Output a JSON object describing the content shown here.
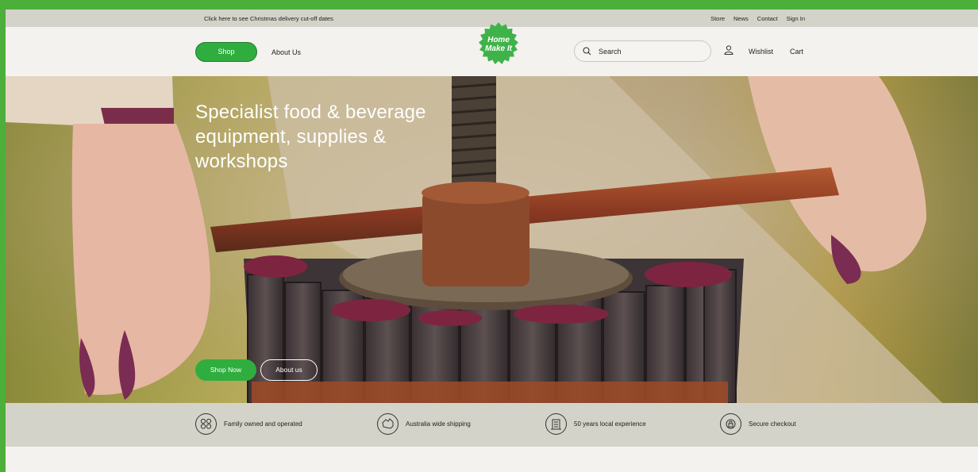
{
  "topbar": {
    "promo": "Click here to see Christmas delivery cut-off dates",
    "links": [
      "Store",
      "News",
      "Contact",
      "Sign In"
    ]
  },
  "header": {
    "shop_label": "Shop",
    "about_label": "About Us",
    "logo_line1": "Home",
    "logo_line2": "Make It",
    "search_placeholder": "Search",
    "wishlist_label": "Wishlist",
    "cart_label": "Cart"
  },
  "hero": {
    "title": "Specialist food & beverage equipment, supplies & workshops",
    "shop_now_label": "Shop Now",
    "about_label": "About us"
  },
  "features": [
    {
      "icon": "family-icon",
      "label": "Family owned and operated"
    },
    {
      "icon": "australia-map-icon",
      "label": "Australia wide shipping"
    },
    {
      "icon": "building-icon",
      "label": "50 years local experience"
    },
    {
      "icon": "lock-icon",
      "label": "Secure checkout"
    }
  ],
  "colors": {
    "accent_green": "#2fae3f",
    "border_green": "#4caf3a",
    "bar_beige": "#d4d3c9",
    "page_bg": "#f3f2ee"
  }
}
